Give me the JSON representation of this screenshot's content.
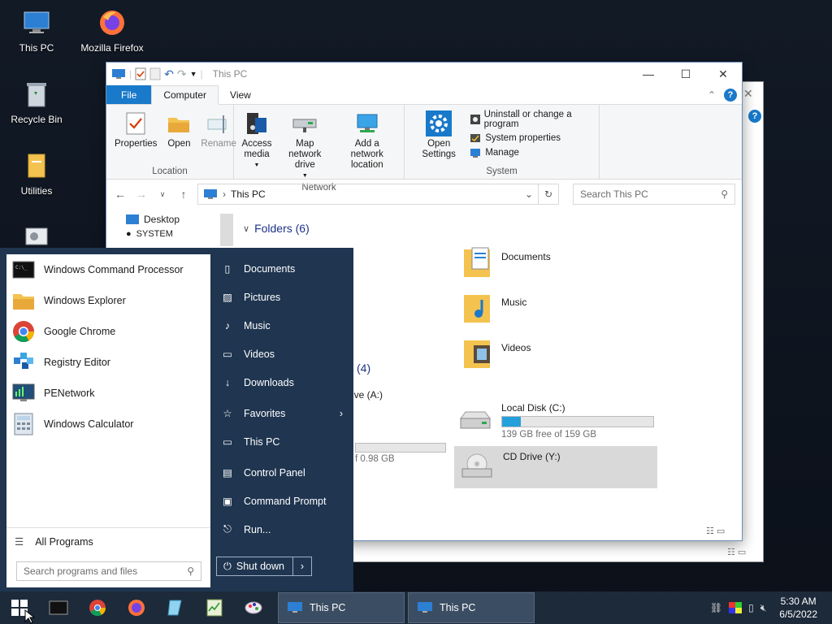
{
  "desktop": {
    "icons": [
      {
        "label": "This PC"
      },
      {
        "label": "Mozilla Firefox"
      },
      {
        "label": "Recycle Bin"
      },
      {
        "label": "Utilities"
      }
    ]
  },
  "explorer": {
    "title": "This PC",
    "tabs": {
      "file": "File",
      "computer": "Computer",
      "view": "View"
    },
    "ribbon": {
      "location": {
        "label": "Location",
        "properties": "Properties",
        "open": "Open",
        "rename": "Rename"
      },
      "network": {
        "label": "Network",
        "access_media": "Access media",
        "map_drive": "Map network drive",
        "add_location": "Add a network location"
      },
      "system": {
        "label": "System",
        "open_settings": "Open Settings",
        "uninstall": "Uninstall or change a program",
        "system_properties": "System properties",
        "manage": "Manage"
      }
    },
    "address": {
      "path": "This PC",
      "search_placeholder": "Search This PC"
    },
    "nav": {
      "desktop": "Desktop",
      "system": "SYSTEM"
    },
    "folders_heading": "Folders (6)",
    "devices_heading_count": "(4)",
    "folders": [
      {
        "label": "Documents"
      },
      {
        "label": "Music"
      },
      {
        "label": "Videos"
      }
    ],
    "drives": {
      "floppy_fragment": "rive (A:)",
      "ram_fragment": "f 0.98 GB",
      "local_disk": {
        "name": "Local Disk (C:)",
        "free": "139 GB free of 159 GB",
        "used_fraction": 0.126
      },
      "cd_drive": {
        "name": "CD Drive (Y:)"
      }
    }
  },
  "start_menu": {
    "programs": [
      {
        "label": "Windows Command Processor",
        "icon": "console-icon"
      },
      {
        "label": "Windows Explorer",
        "icon": "folder-icon"
      },
      {
        "label": "Google Chrome",
        "icon": "chrome-icon"
      },
      {
        "label": "Registry Editor",
        "icon": "registry-icon"
      },
      {
        "label": "PENetwork",
        "icon": "network-monitor-icon"
      },
      {
        "label": "Windows Calculator",
        "icon": "calculator-icon"
      }
    ],
    "all_programs": "All Programs",
    "search_placeholder": "Search programs and files",
    "links": [
      {
        "label": "Documents",
        "icon": "document-icon"
      },
      {
        "label": "Pictures",
        "icon": "picture-icon"
      },
      {
        "label": "Music",
        "icon": "music-icon"
      },
      {
        "label": "Videos",
        "icon": "video-icon"
      },
      {
        "label": "Downloads",
        "icon": "download-icon"
      },
      {
        "label": "Favorites",
        "icon": "star-icon"
      },
      {
        "label": "This PC",
        "icon": "computer-icon"
      },
      {
        "label": "Control Panel",
        "icon": "control-panel-icon"
      },
      {
        "label": "Command Prompt",
        "icon": "console-icon"
      },
      {
        "label": "Run...",
        "icon": "run-icon"
      }
    ],
    "shutdown": "Shut down"
  },
  "taskbar": {
    "tasks": [
      {
        "label": "This PC"
      },
      {
        "label": "This PC"
      }
    ],
    "time": "5:30 AM",
    "date": "6/5/2022"
  }
}
